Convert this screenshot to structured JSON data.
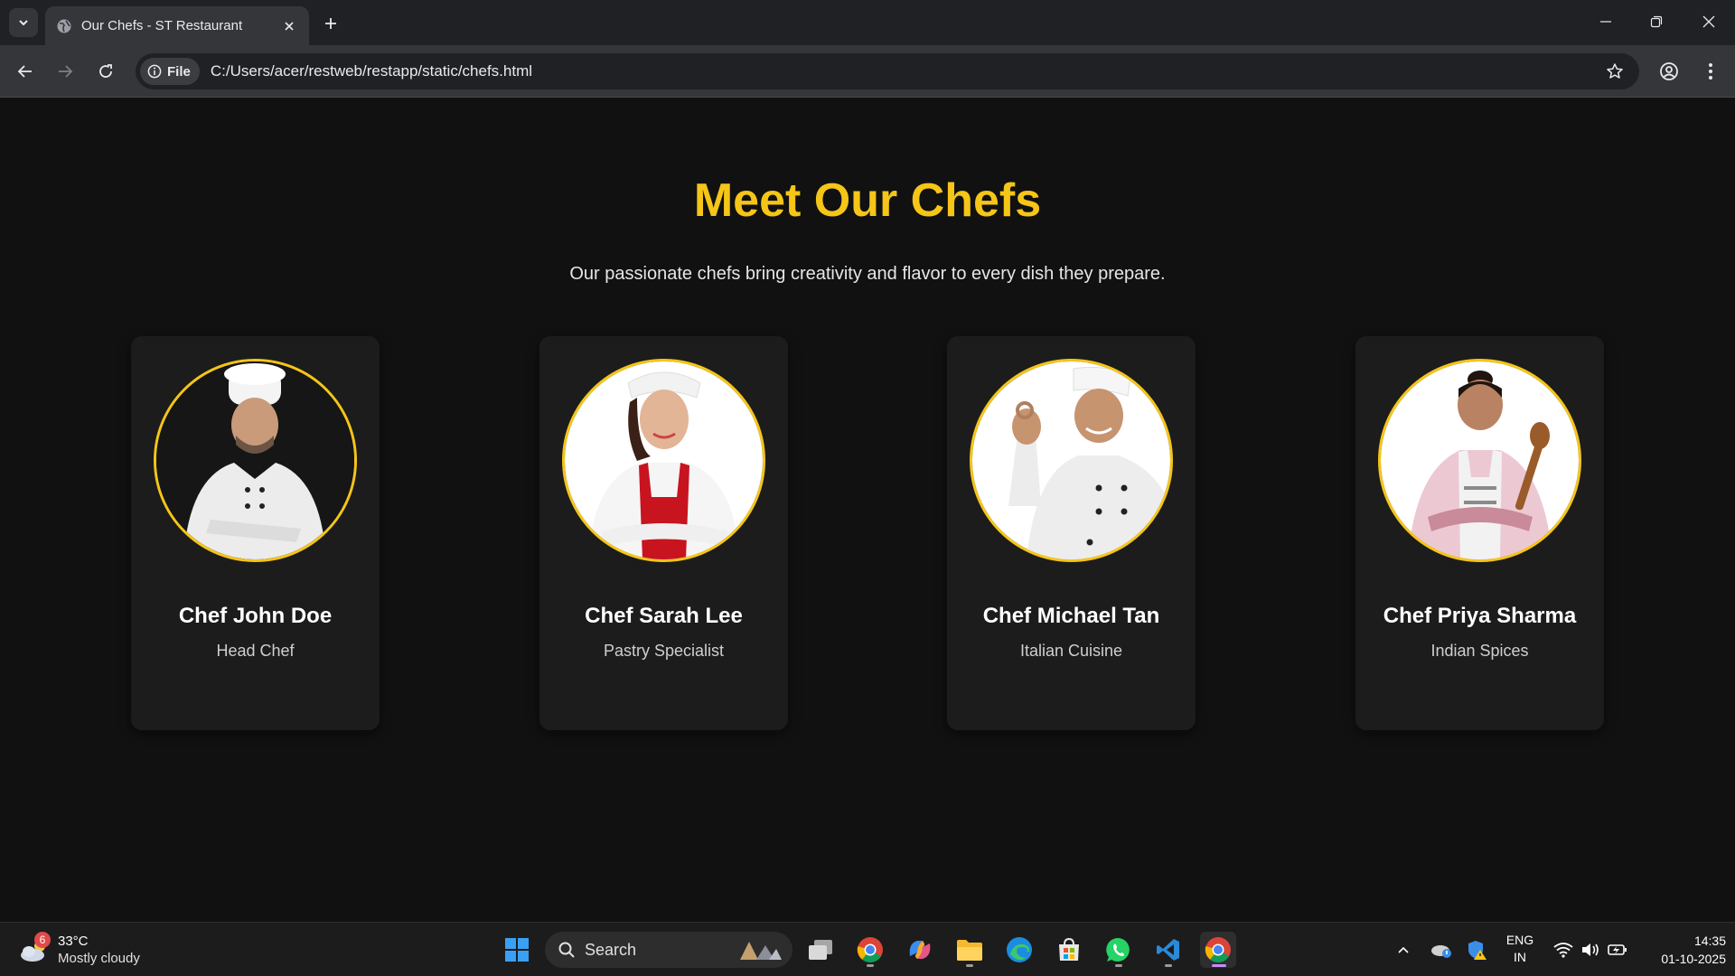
{
  "browser": {
    "tab_title": "Our Chefs - ST Restaurant",
    "file_chip_label": "File",
    "url": "C:/Users/acer/restweb/restapp/static/chefs.html"
  },
  "page": {
    "title": "Meet Our Chefs",
    "subtitle": "Our passionate chefs bring creativity and flavor to every dish they prepare.",
    "chefs": [
      {
        "name": "Chef John Doe",
        "role": "Head Chef"
      },
      {
        "name": "Chef Sarah Lee",
        "role": "Pastry Specialist"
      },
      {
        "name": "Chef Michael Tan",
        "role": "Italian Cuisine"
      },
      {
        "name": "Chef Priya Sharma",
        "role": "Indian Spices"
      }
    ]
  },
  "taskbar": {
    "weather_badge": "6",
    "weather_temp": "33°C",
    "weather_desc": "Mostly cloudy",
    "search_label": "Search",
    "lang_line1": "ENG",
    "lang_line2": "IN",
    "time": "14:35",
    "date": "01-10-2025"
  },
  "colors": {
    "accent": "#f5c518",
    "page_bg": "#111111",
    "card_bg": "#1c1c1c"
  },
  "icons": [
    "tab-search-icon",
    "globe-icon",
    "close-icon",
    "plus-icon",
    "minimize-icon",
    "restore-icon",
    "back-icon",
    "forward-icon",
    "reload-icon",
    "info-icon",
    "star-icon",
    "profile-icon",
    "menu-icon",
    "windows-start-icon",
    "search-icon",
    "chrome-icon",
    "edge-icon",
    "whatsapp-icon",
    "vscode-icon",
    "wifi-icon",
    "volume-icon",
    "battery-icon"
  ]
}
